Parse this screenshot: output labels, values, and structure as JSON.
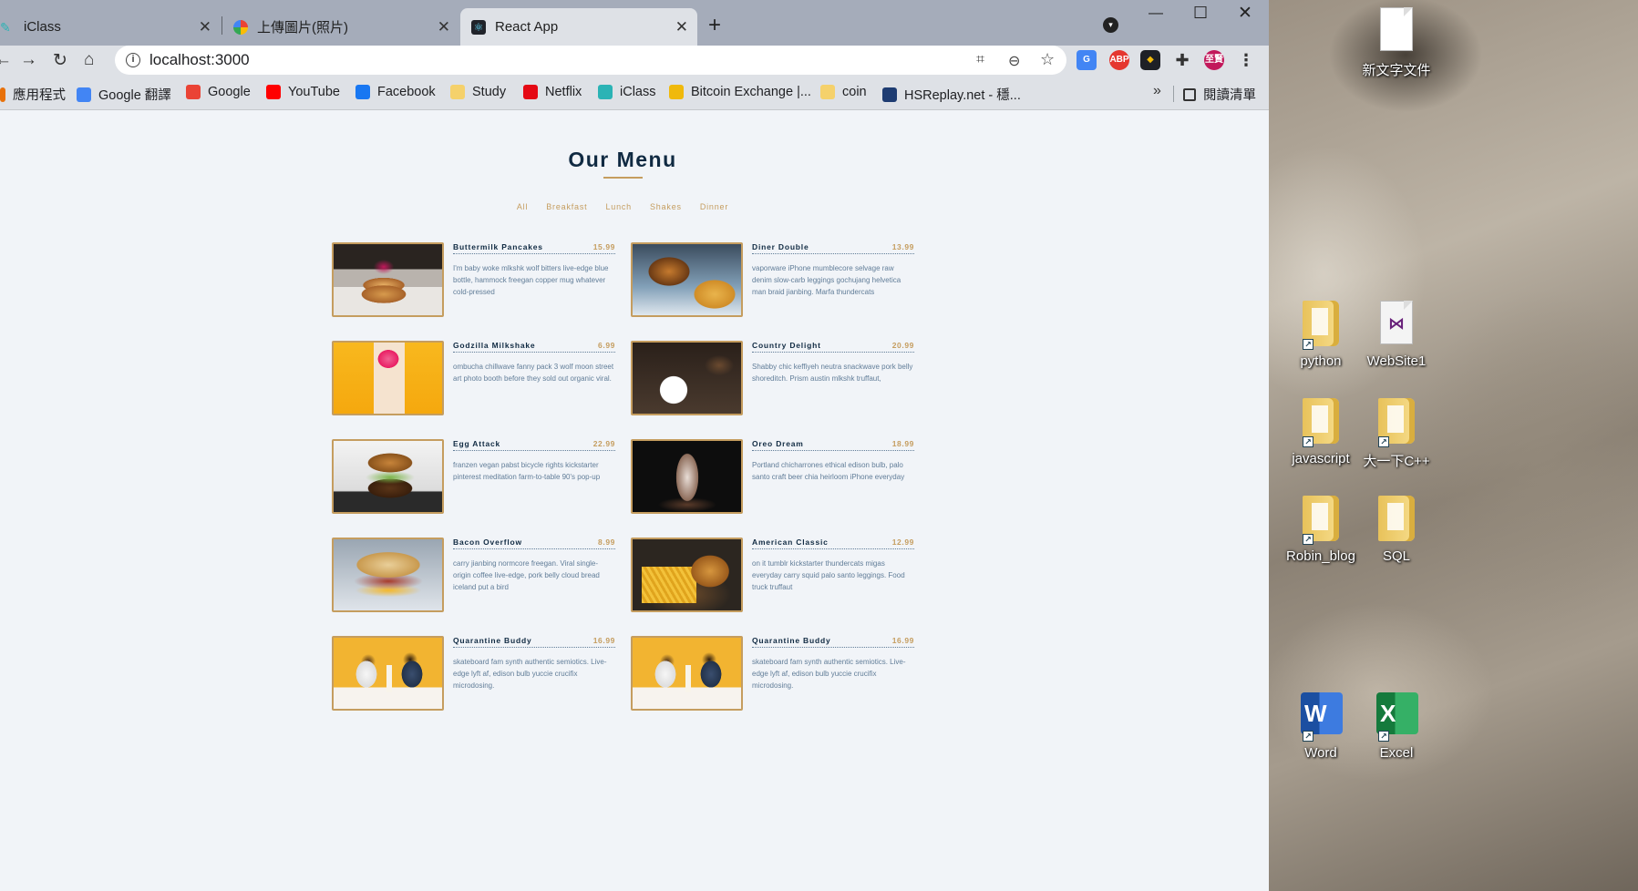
{
  "browser": {
    "tabs": [
      {
        "title": "iClass"
      },
      {
        "title": "上傳圖片(照片)"
      },
      {
        "title": "React App"
      }
    ],
    "url": "localhost:3000",
    "bookmarks": [
      {
        "label": "應用程式",
        "icon": "apps-grid-icon",
        "color": "#e8710a"
      },
      {
        "label": "Google 翻譯",
        "icon": "google-translate-icon",
        "color": "#4285f4"
      },
      {
        "label": "Google",
        "icon": "google-icon",
        "color": "#ea4335"
      },
      {
        "label": "YouTube",
        "icon": "youtube-icon",
        "color": "#ff0000"
      },
      {
        "label": "Facebook",
        "icon": "facebook-icon",
        "color": "#1877f2"
      },
      {
        "label": "Study",
        "icon": "folder-icon",
        "color": "#f5d16b"
      },
      {
        "label": "Netflix",
        "icon": "netflix-icon",
        "color": "#e50914"
      },
      {
        "label": "iClass",
        "icon": "iclass-icon",
        "color": "#2bb3b5"
      },
      {
        "label": "Bitcoin Exchange |...",
        "icon": "binance-icon",
        "color": "#f0b90b"
      },
      {
        "label": "coin",
        "icon": "folder-icon",
        "color": "#f5d16b"
      },
      {
        "label": "HSReplay.net - 穩...",
        "icon": "hsreplay-icon",
        "color": "#1e3c72"
      }
    ],
    "more_label": "»",
    "reading_list": "閱讀清單",
    "profile_label": "至賢"
  },
  "page": {
    "title": "Our Menu",
    "filters": [
      "All",
      "Breakfast",
      "Lunch",
      "Shakes",
      "Dinner"
    ],
    "accent_color": "#c59d5f",
    "items": [
      {
        "name": "Buttermilk Pancakes",
        "price": "15.99",
        "desc": "I'm baby woke mlkshk wolf bitters live-edge blue bottle, hammock freegan copper mug whatever cold-pressed"
      },
      {
        "name": "Diner Double",
        "price": "13.99",
        "desc": "vaporware iPhone mumblecore selvage raw denim slow-carb leggings gochujang helvetica man braid jianbing. Marfa thundercats"
      },
      {
        "name": "Godzilla Milkshake",
        "price": "6.99",
        "desc": "ombucha chillwave fanny pack 3 wolf moon street art photo booth before they sold out organic viral."
      },
      {
        "name": "Country Delight",
        "price": "20.99",
        "desc": "Shabby chic keffiyeh neutra snackwave pork belly shoreditch. Prism austin mlkshk truffaut,"
      },
      {
        "name": "Egg Attack",
        "price": "22.99",
        "desc": "franzen vegan pabst bicycle rights kickstarter pinterest meditation farm-to-table 90's pop-up"
      },
      {
        "name": "Oreo Dream",
        "price": "18.99",
        "desc": "Portland chicharrones ethical edison bulb, palo santo craft beer chia heirloom iPhone everyday"
      },
      {
        "name": "Bacon Overflow",
        "price": "8.99",
        "desc": "carry jianbing normcore freegan. Viral single-origin coffee live-edge, pork belly cloud bread iceland put a bird"
      },
      {
        "name": "American Classic",
        "price": "12.99",
        "desc": "on it tumblr kickstarter thundercats migas everyday carry squid palo santo leggings. Food truck truffaut"
      },
      {
        "name": "Quarantine Buddy",
        "price": "16.99",
        "desc": "skateboard fam synth authentic semiotics. Live-edge lyft af, edison bulb yuccie crucifix microdosing."
      },
      {
        "name": "Quarantine Buddy",
        "price": "16.99",
        "desc": "skateboard fam synth authentic semiotics. Live-edge lyft af, edison bulb yuccie crucifix microdosing."
      }
    ]
  },
  "desktop": {
    "icons": [
      {
        "label": "新文字文件",
        "icon": "text-document-icon"
      },
      {
        "label": "python",
        "icon": "folder-icon"
      },
      {
        "label": "WebSite1",
        "icon": "visual-studio-icon"
      },
      {
        "label": "javascript",
        "icon": "folder-icon"
      },
      {
        "label": "大一下C++",
        "icon": "folder-icon"
      },
      {
        "label": "Robin_blog",
        "icon": "folder-icon"
      },
      {
        "label": "SQL",
        "icon": "folder-icon"
      },
      {
        "label": "Word",
        "icon": "word-icon",
        "letter": "W"
      },
      {
        "label": "Excel",
        "icon": "excel-icon",
        "letter": "X"
      }
    ]
  }
}
